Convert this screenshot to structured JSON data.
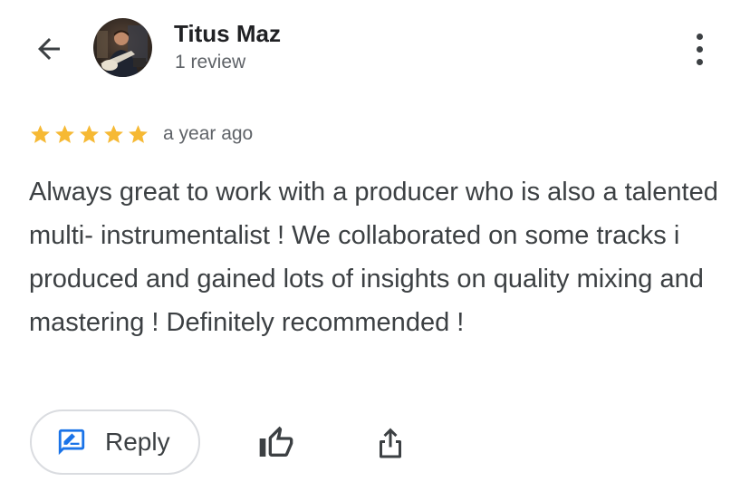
{
  "header": {
    "back_icon": "arrow-back-icon",
    "reviewer_name": "Titus Maz",
    "review_count": "1 review",
    "more_icon": "more-vert-icon"
  },
  "rating": {
    "stars": 5,
    "max_stars": 5,
    "star_color": "#f6b934",
    "time": "a year ago"
  },
  "review": {
    "text": "Always great to work with a producer who is also a talented multi- instrumentalist ! We collaborated on some tracks i produced and gained lots of insights on quality mixing and mastering ! Definitely recommended !"
  },
  "actions": {
    "reply_label": "Reply",
    "reply_icon": "rate-review-icon",
    "reply_icon_color": "#1a73e8",
    "like_icon": "thumb-up-outline-icon",
    "share_icon": "share-icon"
  }
}
